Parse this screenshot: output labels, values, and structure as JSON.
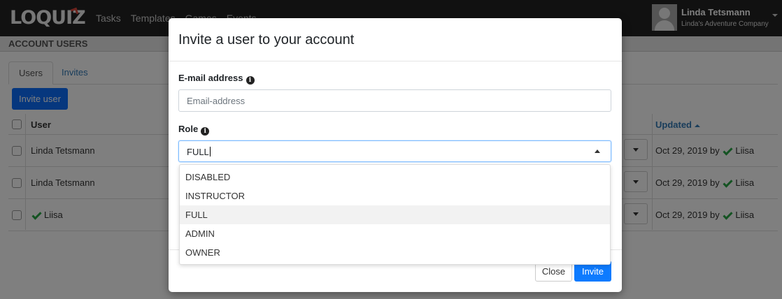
{
  "app": {
    "logo": "LOQUIZ",
    "nav": [
      "Tasks",
      "Templates",
      "Games",
      "Events"
    ],
    "user": {
      "name": "Linda Tetsmann",
      "company": "Linda's Adventure Company"
    }
  },
  "page": {
    "section_title": "ACCOUNT USERS",
    "tabs": [
      "Users",
      "Invites"
    ],
    "invite_button": "Invite user",
    "table": {
      "headers": {
        "user": "User",
        "updated": "Updated"
      },
      "rows": [
        {
          "user": "Linda Tetsmann",
          "user_verified": false,
          "updated_date": "Oct 29, 2019 by",
          "updated_by": "Liisa"
        },
        {
          "user": "Linda Tetsmann",
          "user_verified": false,
          "updated_date": "Oct 29, 2019 by",
          "updated_by": "Liisa"
        },
        {
          "user": "Liisa",
          "user_verified": true,
          "updated_date": "Oct 29, 2019 by",
          "updated_by": "Liisa"
        }
      ]
    }
  },
  "modal": {
    "title": "Invite a user to your account",
    "email": {
      "label": "E-mail address",
      "placeholder": "Email-address",
      "value": ""
    },
    "role": {
      "label": "Role",
      "value": "FULL",
      "options": [
        "DISABLED",
        "INSTRUCTOR",
        "FULL",
        "ADMIN",
        "OWNER"
      ],
      "highlighted": "FULL"
    },
    "buttons": {
      "close": "Close",
      "invite": "Invite"
    }
  },
  "colors": {
    "primary": "#0d7bff",
    "verified_check": "#28a745",
    "topbar": "#222222",
    "link": "#337ab7"
  },
  "icons": {
    "info": "info-circle-icon",
    "check": "check-icon",
    "caret": "caret-icon"
  }
}
